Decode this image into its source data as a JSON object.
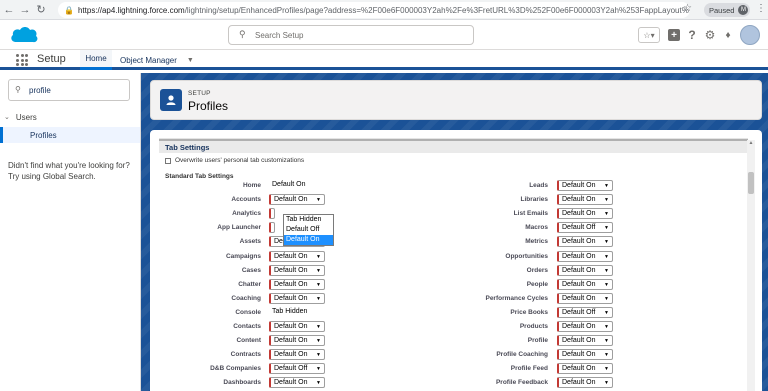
{
  "browser": {
    "url_host": "https://ap4.lightning.force.com",
    "url_path": "/lightning/setup/EnhancedProfiles/page?address=%2F00e6F000003Y2ah%2Fe%3FretURL%3D%252F00e6F000003Y2ah%253FappLayout%...",
    "paused_label": "Paused",
    "avatar_letter": "M"
  },
  "header": {
    "search_placeholder": "Search Setup"
  },
  "appnav": {
    "app_name": "Setup",
    "tabs": [
      {
        "label": "Home"
      },
      {
        "label": "Object Manager"
      }
    ]
  },
  "sidebar": {
    "quick_find_value": "profile",
    "tree": {
      "parent": "Users",
      "child": "Profiles"
    },
    "not_found_text": "Didn't find what you're looking for? Try using Global Search."
  },
  "page_header": {
    "breadcrumb": "SETUP",
    "title": "Profiles"
  },
  "tab_settings": {
    "section_title": "Tab Settings",
    "overwrite_label": "Overwrite users' personal tab customizations",
    "standard_label": "Standard Tab Settings",
    "left_rows": [
      {
        "label": "Home",
        "value": "Default On",
        "type": "static"
      },
      {
        "label": "Accounts",
        "value": "Default On",
        "type": "select"
      },
      {
        "label": "Analytics",
        "value": "",
        "type": "hidden"
      },
      {
        "label": "App Launcher",
        "value": "",
        "type": "hidden"
      },
      {
        "label": "Assets",
        "value": "Default On",
        "type": "select"
      },
      {
        "label": "Campaigns",
        "value": "Default On",
        "type": "select"
      },
      {
        "label": "Cases",
        "value": "Default On",
        "type": "select"
      },
      {
        "label": "Chatter",
        "value": "Default On",
        "type": "select"
      },
      {
        "label": "Coaching",
        "value": "Default On",
        "type": "select"
      },
      {
        "label": "Console",
        "value": "Tab Hidden",
        "type": "static"
      },
      {
        "label": "Contacts",
        "value": "Default On",
        "type": "select"
      },
      {
        "label": "Content",
        "value": "Default On",
        "type": "select"
      },
      {
        "label": "Contracts",
        "value": "Default On",
        "type": "select"
      },
      {
        "label": "D&B Companies",
        "value": "Default Off",
        "type": "select"
      },
      {
        "label": "Dashboards",
        "value": "Default On",
        "type": "select"
      }
    ],
    "right_rows": [
      {
        "label": "Leads",
        "value": "Default On"
      },
      {
        "label": "Libraries",
        "value": "Default On"
      },
      {
        "label": "List Emails",
        "value": "Default On"
      },
      {
        "label": "Macros",
        "value": "Default Off"
      },
      {
        "label": "Metrics",
        "value": "Default On"
      },
      {
        "label": "Opportunities",
        "value": "Default On"
      },
      {
        "label": "Orders",
        "value": "Default On"
      },
      {
        "label": "People",
        "value": "Default On"
      },
      {
        "label": "Performance Cycles",
        "value": "Default On"
      },
      {
        "label": "Price Books",
        "value": "Default Off"
      },
      {
        "label": "Products",
        "value": "Default On"
      },
      {
        "label": "Profile",
        "value": "Default On"
      },
      {
        "label": "Profile Coaching",
        "value": "Default On"
      },
      {
        "label": "Profile Feed",
        "value": "Default On"
      },
      {
        "label": "Profile Feedback",
        "value": "Default On"
      }
    ],
    "dropdown_options": [
      "Tab Hidden",
      "Default Off",
      "Default On"
    ],
    "dropdown_selected": "Default On"
  }
}
